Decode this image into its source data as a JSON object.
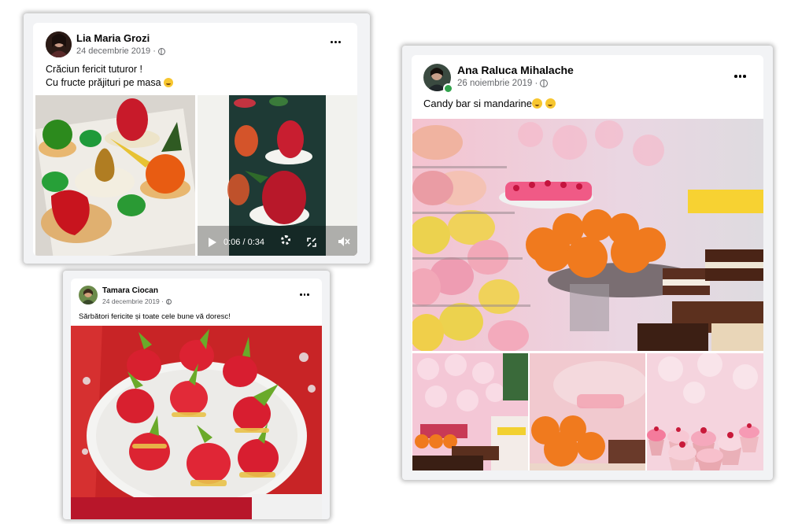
{
  "post1": {
    "author": "Lia Maria Grozi",
    "date": "24 decembrie 2019 ·",
    "line1": "Crăciun fericit tuturor !",
    "line2": "Cu fructe prăjituri pe masa",
    "video_time": "0:06 / 0:34",
    "icons": [
      "more-options-icon",
      "globe-icon",
      "play-icon",
      "settings-icon",
      "fullscreen-icon",
      "mute-icon"
    ]
  },
  "post2": {
    "author": "Tamara Ciocan",
    "date": "24 decembrie 2019 ·",
    "text": "Sărbători fericite și toate cele bune vă doresc!",
    "icons": [
      "more-options-icon",
      "globe-icon"
    ]
  },
  "post3": {
    "author": "Ana Raluca Mihalache",
    "date": "26 noiembrie 2019 ·",
    "text": "Candy bar si mandarine",
    "icons": [
      "more-options-icon",
      "globe-icon",
      "online-status-icon"
    ]
  },
  "colors": {
    "name": "#050505",
    "meta": "#65676b",
    "frame": "#f2f3f5",
    "online": "#31a24c",
    "macaron_pink": "#f2a8b8",
    "macaron_yellow": "#f0d25a",
    "mandarin": "#f07a1e"
  }
}
